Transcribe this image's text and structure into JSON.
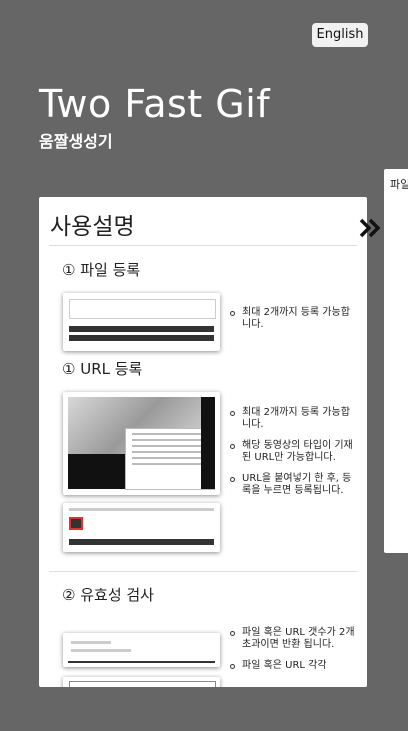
{
  "header": {
    "language_button": "English",
    "title": "Two Fast Gif",
    "subtitle": "움짤생성기"
  },
  "guide": {
    "title": "사용설명",
    "sections": [
      {
        "heading": "① 파일 등록",
        "notes": [
          "최대 2개까지 등록 가능합니다."
        ]
      },
      {
        "heading": "① URL 등록",
        "notes": [
          "최대 2개까지 등록 가능합니다.",
          "해당 동영상의 타입이 기재된 URL만 가능합니다.",
          "URL을 붙여넣기 한 후, 등록을 누르면 등록됩니다."
        ]
      },
      {
        "heading": "② 유효성 검사",
        "notes": [
          "파일 혹은 URL 갯수가 2개 초과이면 반환 됩니다.",
          "파일 혹은 URL 각각"
        ]
      }
    ]
  },
  "side_panel": {
    "label": "파일"
  },
  "colors": {
    "background": "#666666",
    "panel": "#ffffff",
    "text": "#222222"
  },
  "icons": {
    "expand": "double-chevron-right-icon"
  }
}
